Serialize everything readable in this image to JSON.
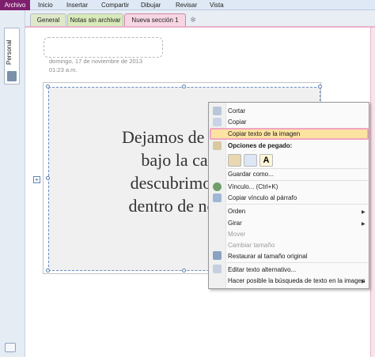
{
  "ribbon": {
    "file_tab": "Archivo",
    "tabs": [
      "Inicio",
      "Insertar",
      "Compartir",
      "Dibujar",
      "Revisar",
      "Vista"
    ]
  },
  "notebook": {
    "label": "Personal"
  },
  "sections": {
    "tabs": [
      "General",
      "Notas sin archivar",
      "Nueva sección 1"
    ],
    "add_symbol": "✻"
  },
  "page": {
    "date": "domingo, 17 de noviembre de 2013",
    "time": "01:23 a.m."
  },
  "image": {
    "lines": [
      "Dejamos de busca",
      "bajo la cama",
      "descubrimos qu",
      "dentro de nosotr"
    ]
  },
  "context_menu": {
    "items": {
      "cortar": "Cortar",
      "copiar": "Copiar",
      "copiar_texto": "Copiar texto de la imagen",
      "opciones_pegado": "Opciones de pegado:",
      "guardar_como": "Guardar como...",
      "vinculo": "Vínculo... (Ctrl+K)",
      "copiar_vinculo": "Copiar vínculo al párrafo",
      "orden": "Orden",
      "girar": "Girar",
      "mover": "Mover",
      "cambiar_tamano": "Cambiar tamaño",
      "restaurar": "Restaurar al tamaño original",
      "texto_alt": "Editar texto alternativo...",
      "busqueda": "Hacer posible la búsqueda de texto en la imagen"
    },
    "paste_letter": "A",
    "submenu_arrow": "▶",
    "highlight_color": "#fce3a1",
    "highlight_border": "#f2a6c2"
  }
}
